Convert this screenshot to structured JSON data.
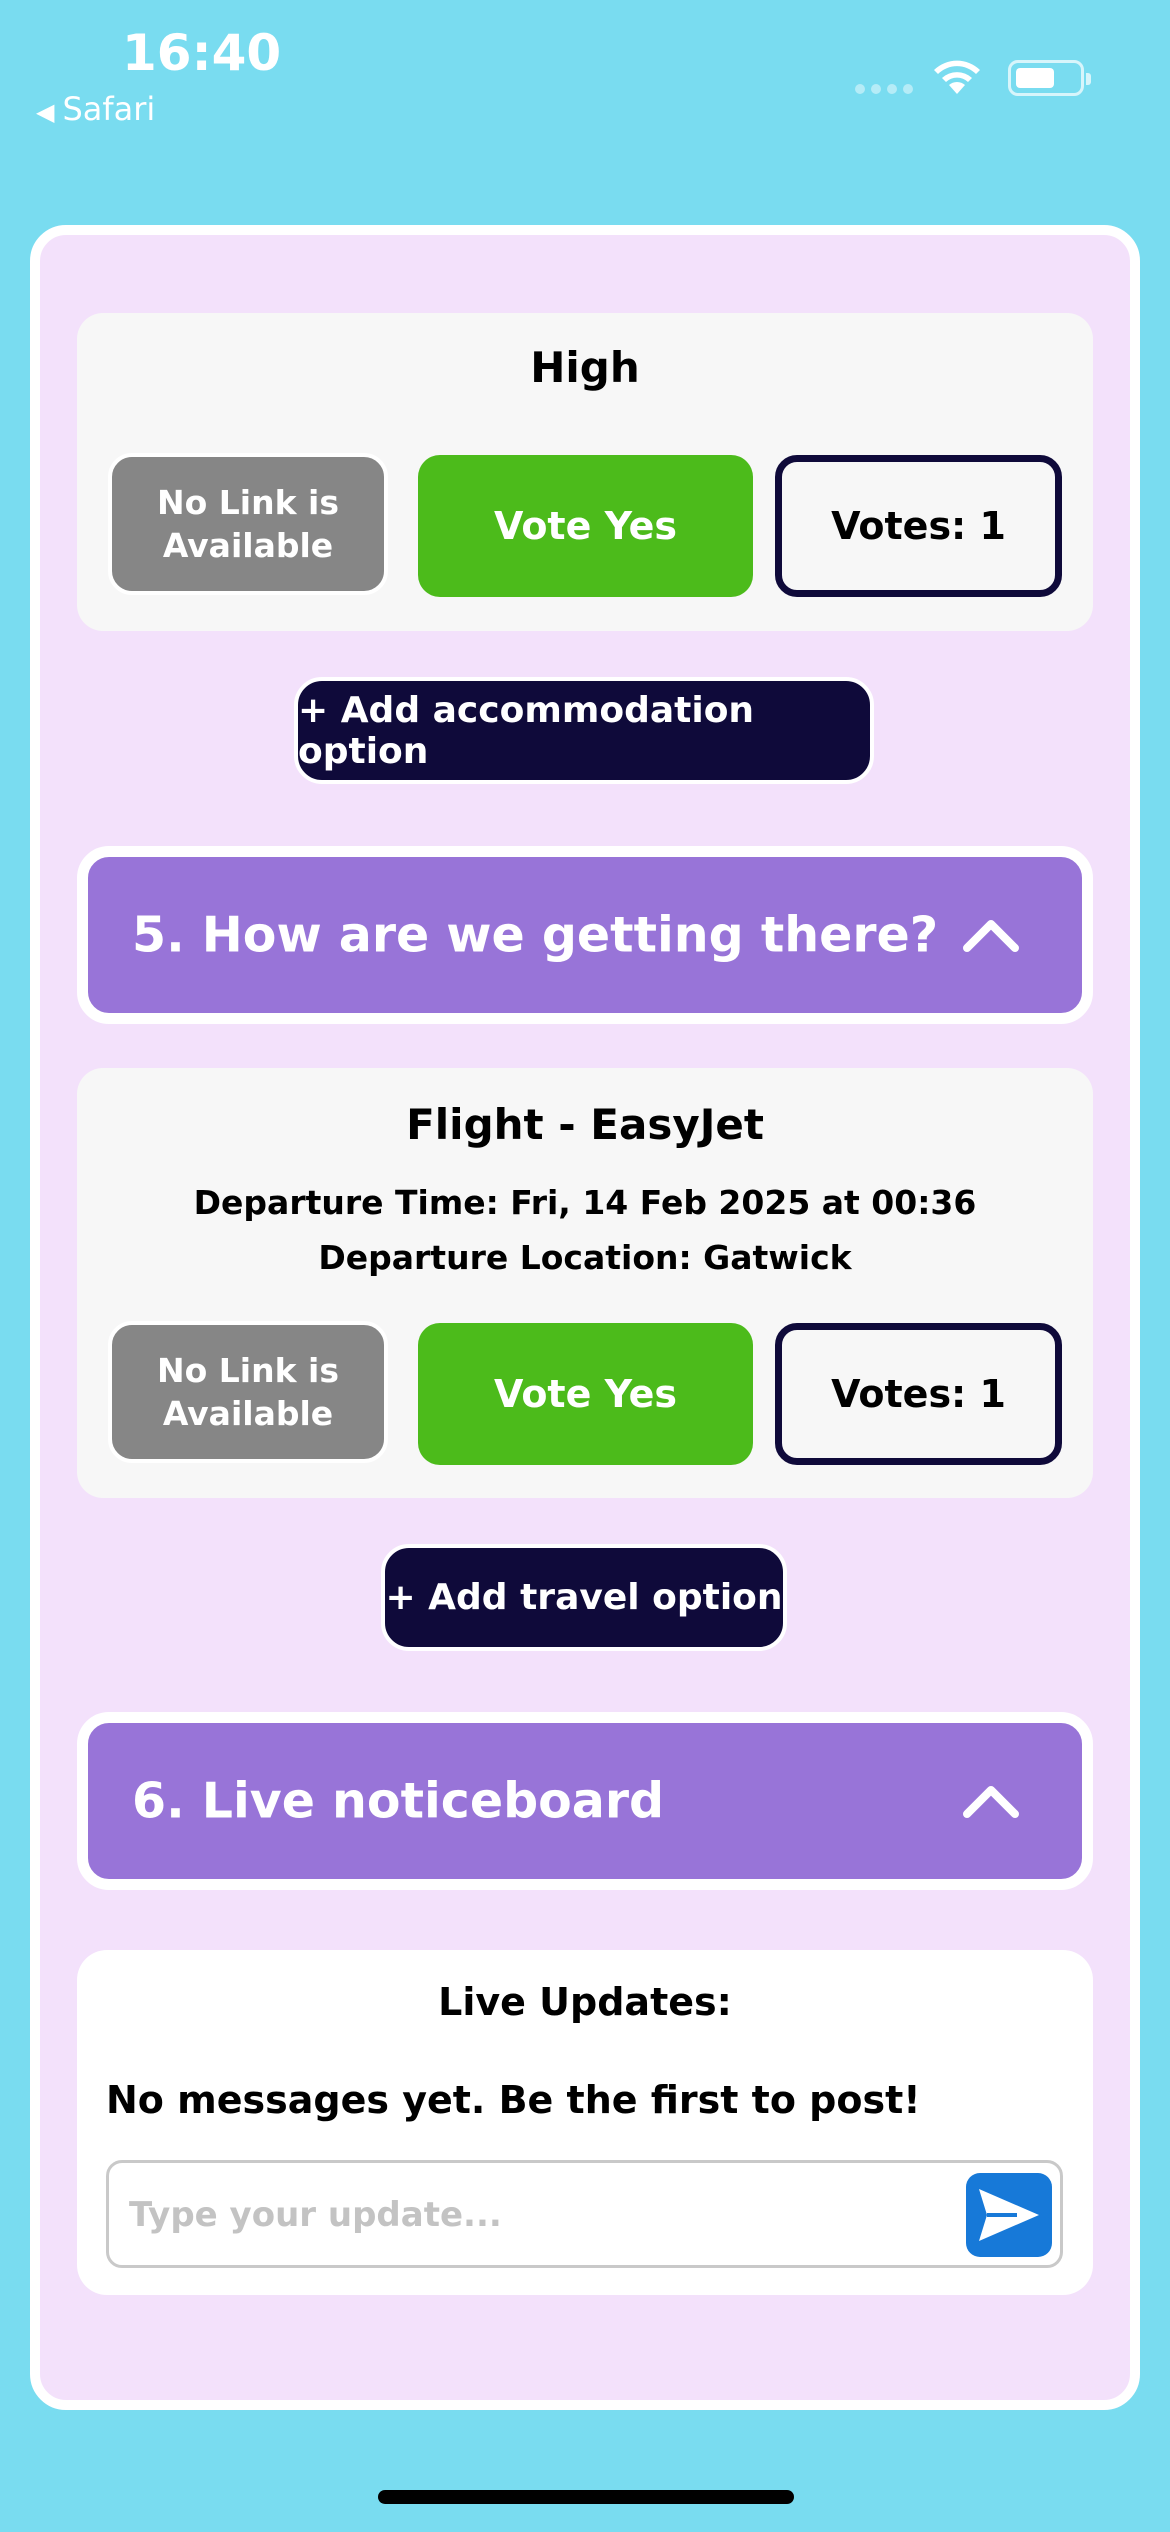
{
  "status_bar": {
    "time": "16:40",
    "back_app": "Safari"
  },
  "accommodation_card": {
    "title": "High",
    "no_link_label": "No Link is Available",
    "vote_label": "Vote Yes",
    "votes_label": "Votes: 1"
  },
  "add_accommodation_label": "+ Add accommodation option",
  "section5": {
    "title": "5. How are we getting there?",
    "icon": "chevron-up-icon"
  },
  "travel_card": {
    "title": "Flight - EasyJet",
    "departure_time": "Departure Time: Fri, 14 Feb 2025 at 00:36",
    "departure_location": "Departure Location: Gatwick",
    "no_link_label": "No Link is Available",
    "vote_label": "Vote Yes",
    "votes_label": "Votes: 1"
  },
  "add_travel_label": "+ Add travel option",
  "section6": {
    "title": "6. Live noticeboard",
    "icon": "chevron-up-icon"
  },
  "noticeboard": {
    "title": "Live Updates:",
    "empty_message": "No messages yet. Be the first to post!",
    "input_placeholder": "Type your update...",
    "send_icon": "send-icon"
  },
  "colors": {
    "background": "#79dcf0",
    "panel": "#f3e1fb",
    "section_header": "#9874d8",
    "vote_green": "#4cbb1b",
    "navy": "#0f0a3a",
    "no_link_grey": "#868686",
    "send_blue": "#1779d8"
  }
}
